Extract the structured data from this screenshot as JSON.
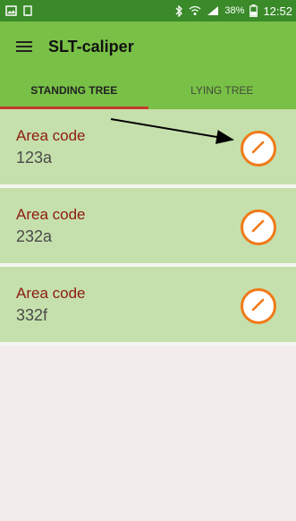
{
  "status_bar": {
    "battery_percent": "38%",
    "time": "12:52"
  },
  "toolbar": {
    "title": "SLT-caliper"
  },
  "tabs": [
    {
      "label": "STANDING TREE",
      "active": true
    },
    {
      "label": "LYING TREE",
      "active": false
    }
  ],
  "list": [
    {
      "label": "Area code",
      "value": "123a"
    },
    {
      "label": "Area code",
      "value": "232a"
    },
    {
      "label": "Area code",
      "value": "332f"
    }
  ],
  "colors": {
    "toolbar": "#79c047",
    "status_bar": "#3a8a2a",
    "row": "#c5e0ac",
    "accent": "#f07a18",
    "label": "#8e1b10"
  }
}
